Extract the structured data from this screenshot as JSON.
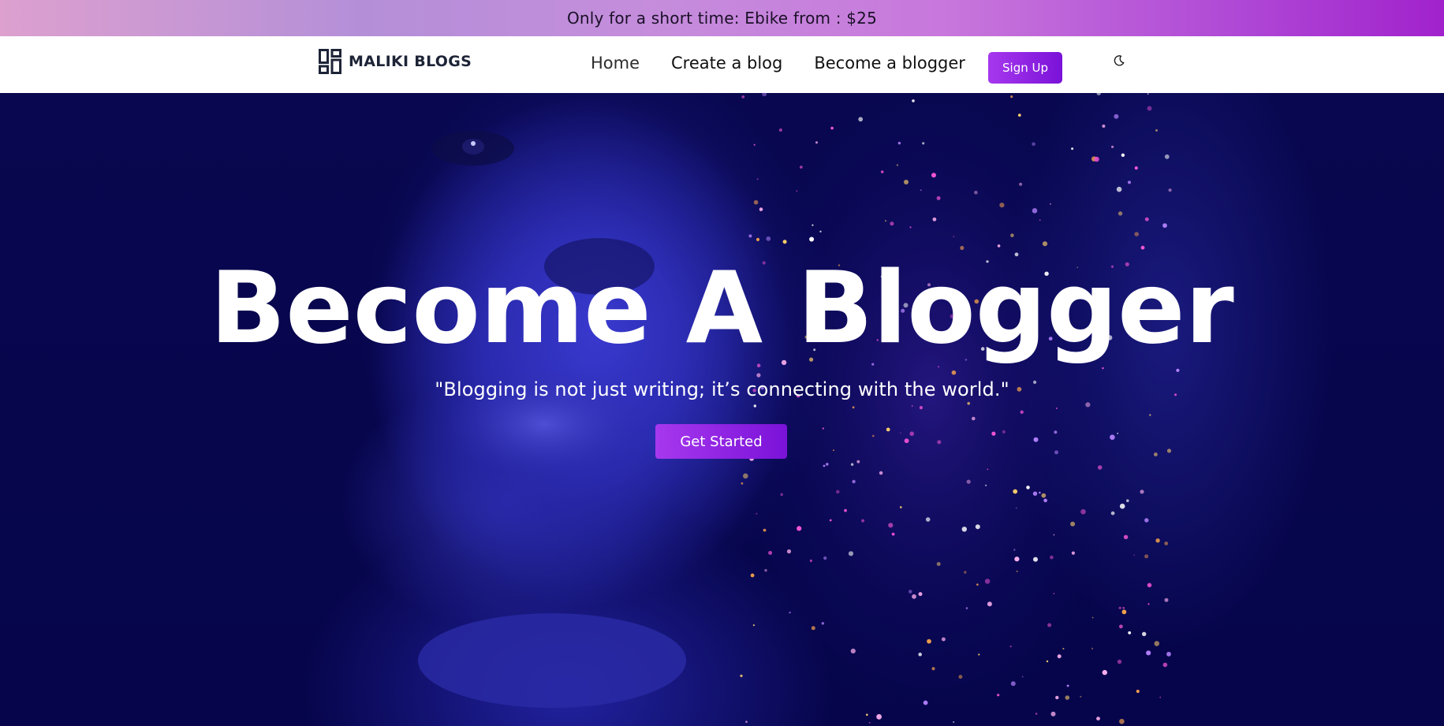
{
  "promo": {
    "text": "Only for a short time: Ebike from : $25"
  },
  "navbar": {
    "logo_text": "MALIKI BLOGS",
    "links": [
      {
        "label": "Home"
      },
      {
        "label": "Create a blog"
      },
      {
        "label": "Become a blogger"
      }
    ],
    "signup_label": "Sign Up",
    "theme_icon": "moon-icon"
  },
  "hero": {
    "title": "Become A Blogger",
    "quote": "\"Blogging is not just writing; it’s connecting with the world.\"",
    "cta_label": "Get Started"
  },
  "colors": {
    "accent": "#9b2ae6",
    "hero_background": "#06054b",
    "navbar_background": "#ffffff"
  }
}
